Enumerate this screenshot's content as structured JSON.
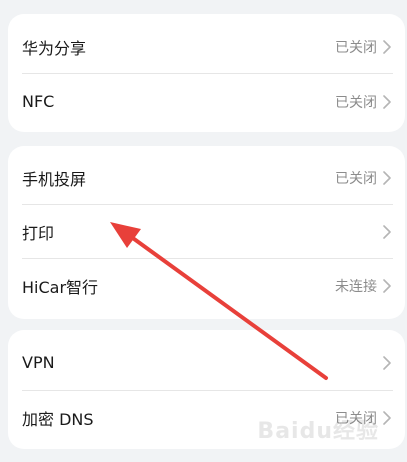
{
  "settings": {
    "group1": [
      {
        "label": "华为分享",
        "value": "已关闭"
      },
      {
        "label": "NFC",
        "value": "已关闭"
      }
    ],
    "group2": [
      {
        "label": "手机投屏",
        "value": "已关闭"
      },
      {
        "label": "打印",
        "value": ""
      },
      {
        "label": "HiCar智行",
        "value": "未连接"
      }
    ],
    "group3": [
      {
        "label": "VPN",
        "value": ""
      },
      {
        "label": "加密 DNS",
        "value": "已关闭"
      }
    ]
  },
  "annotation": {
    "color": "#e8403a"
  },
  "watermark": "Baidu经验"
}
